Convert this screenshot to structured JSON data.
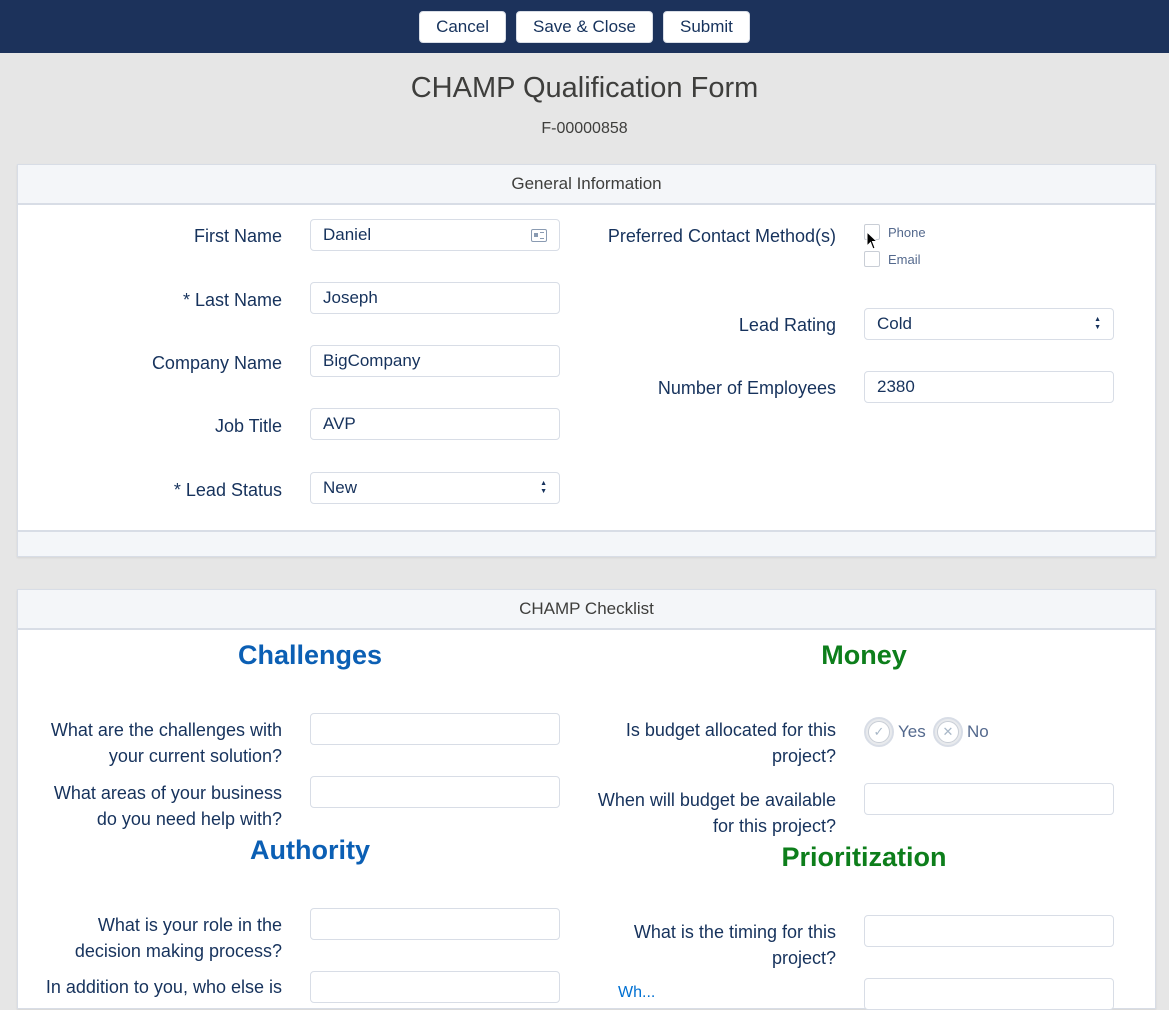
{
  "toolbar": {
    "cancel_label": "Cancel",
    "save_close_label": "Save & Close",
    "submit_label": "Submit"
  },
  "form": {
    "title": "CHAMP Qualification Form",
    "id": "F-00000858"
  },
  "general": {
    "header": "General Information",
    "first_name_label": "First Name",
    "first_name_value": "Daniel",
    "last_name_label": "* Last Name",
    "last_name_value": "Joseph",
    "company_label": "Company Name",
    "company_value": "BigCompany",
    "job_title_label": "Job Title",
    "job_title_value": "AVP",
    "lead_status_label": "* Lead Status",
    "lead_status_value": "New",
    "contact_method_label": "Preferred Contact Method(s)",
    "contact_options": [
      "Phone",
      "Email"
    ],
    "lead_rating_label": "Lead Rating",
    "lead_rating_value": "Cold",
    "employees_label": "Number of Employees",
    "employees_value": "2380"
  },
  "checklist": {
    "header": "CHAMP Checklist",
    "challenges_heading": "Challenges",
    "money_heading": "Money",
    "authority_heading": "Authority",
    "prioritization_heading": "Prioritization",
    "challenges_q1_line1": "What are the challenges with",
    "challenges_q1_line2": "your current solution?",
    "challenges_q2_line1": "What areas of your business",
    "challenges_q2_line2": "do you need help with?",
    "money_q1_line1": "Is budget allocated for this",
    "money_q1_line2": "project?",
    "yes_label": "Yes",
    "no_label": "No",
    "money_q2_line1": "When will budget be available",
    "money_q2_line2": "for this project?",
    "authority_q1_line1": "What is your role in the",
    "authority_q1_line2": "decision making process?",
    "authority_q2_line1": "In addition to you, who else is",
    "prio_q1_line1": "What is the timing for this",
    "prio_q1_line2": "project?",
    "prio_q2_partial": "Wh..."
  },
  "colors": {
    "topbar": "#1c325b",
    "heading_blue": "#0b5fb4",
    "heading_green": "#0d7e1b",
    "label": "#16325c"
  }
}
